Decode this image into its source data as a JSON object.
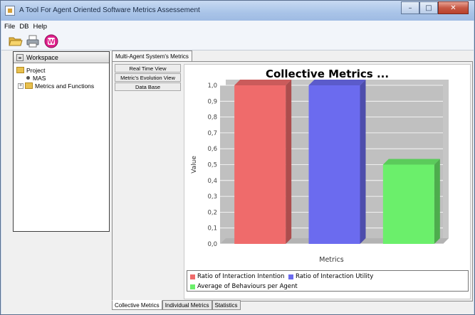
{
  "window": {
    "title": "A Tool For Agent Oriented Software Metrics Assessement",
    "buttons": {
      "minimize": "–",
      "maximize": "□",
      "close": "✕"
    }
  },
  "menu": [
    "File",
    "DB",
    "Help"
  ],
  "toolbar": {
    "icons": [
      "open-folder-icon",
      "printer-icon",
      "database-icon"
    ]
  },
  "workspace": {
    "title": "Workspace",
    "tree": {
      "root": "Project",
      "children": [
        {
          "label": "MAS",
          "type": "leaf"
        },
        {
          "label": "Metrics and Functions",
          "type": "folder",
          "expander": "+"
        }
      ]
    }
  },
  "main": {
    "tab": "Multi-Agent System's Metrics",
    "views": [
      "Real Time View",
      "Metric's Evolution View",
      "Data Base"
    ],
    "bottom_tabs": [
      "Collective Metrics",
      "Individual Metrics",
      "Statistics"
    ],
    "active_bottom_tab": 0
  },
  "chart_data": {
    "type": "bar",
    "title": "Collective Metrics ...",
    "xlabel": "Metrics",
    "ylabel": "Value",
    "ylim": [
      0,
      1.0
    ],
    "yticks": [
      "0,0",
      "0,1",
      "0,2",
      "0,3",
      "0,4",
      "0,5",
      "0,6",
      "0,7",
      "0,8",
      "0,9",
      "1,0"
    ],
    "grid": true,
    "legend_position": "bottom",
    "series": [
      {
        "name": "Ratio of Interaction Intention",
        "values": [
          1.0
        ],
        "color": "#ef6b6b"
      },
      {
        "name": "Ratio of Interaction Utility",
        "values": [
          1.0
        ],
        "color": "#6b6bef"
      },
      {
        "name": "Average of Behaviours per Agent",
        "values": [
          0.5
        ],
        "color": "#6bef6b"
      }
    ]
  }
}
